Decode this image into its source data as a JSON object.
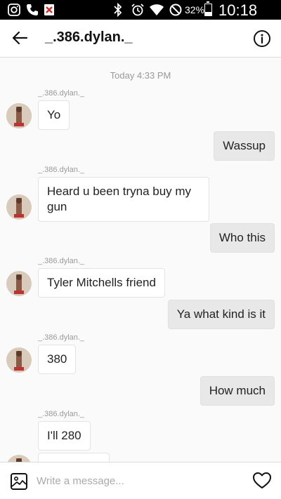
{
  "status_bar": {
    "battery_percent": "32%",
    "battery_level": 0.32,
    "time": "10:18 PM",
    "icons": [
      "instagram-icon",
      "phone-icon",
      "missed-call-icon",
      "bluetooth-icon",
      "alarm-icon",
      "wifi-icon",
      "do-not-disturb-icon",
      "battery-icon"
    ]
  },
  "header": {
    "title": "_.386.dylan._",
    "back_icon": "arrow-left-icon",
    "info_icon": "info-icon"
  },
  "thread": {
    "timestamp": "Today 4:33 PM",
    "messages": [
      {
        "direction": "in",
        "sender": "_.386.dylan._",
        "text": "Yo"
      },
      {
        "direction": "out",
        "text": "Wassup"
      },
      {
        "direction": "in",
        "sender": "_.386.dylan._",
        "text": "Heard u been tryna buy my gun"
      },
      {
        "direction": "out",
        "text": "Who this"
      },
      {
        "direction": "in",
        "sender": "_.386.dylan._",
        "text": "Tyler Mitchells friend"
      },
      {
        "direction": "out",
        "text": "Ya what kind is it"
      },
      {
        "direction": "in",
        "sender": "_.386.dylan._",
        "text": "380"
      },
      {
        "direction": "out",
        "text": "How much"
      },
      {
        "direction": "in",
        "sender": "_.386.dylan._",
        "text": "I'll 280"
      }
    ]
  },
  "composer": {
    "placeholder": "Write a message...",
    "value": "",
    "gallery_icon": "image-icon",
    "like_icon": "heart-icon"
  },
  "colors": {
    "incoming_bubble": "#ffffff",
    "outgoing_bubble": "#e8e8e8",
    "status_bar": "#000000"
  }
}
